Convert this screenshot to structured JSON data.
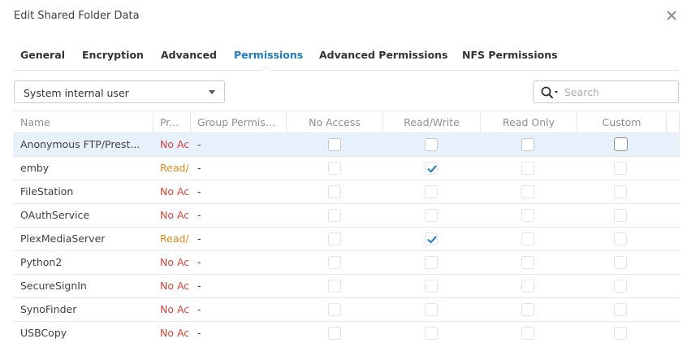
{
  "dialog": {
    "title": "Edit Shared Folder Data"
  },
  "tabs": [
    {
      "label": "General",
      "active": false
    },
    {
      "label": "Encryption",
      "active": false
    },
    {
      "label": "Advanced",
      "active": false
    },
    {
      "label": "Permissions",
      "active": true
    },
    {
      "label": "Advanced Permissions",
      "active": false
    },
    {
      "label": "NFS Permissions",
      "active": false
    }
  ],
  "filter": {
    "selected": "System internal user"
  },
  "search": {
    "placeholder": "Search"
  },
  "columns": {
    "name": "Name",
    "privilege": "Pr...",
    "group": "Group Permis...",
    "no_access": "No Access",
    "read_write": "Read/Write",
    "read_only": "Read Only",
    "custom": "Custom"
  },
  "rows": [
    {
      "name": "Anonymous FTP/Prest...",
      "privilege": "No Ac",
      "privilege_kind": "no",
      "group": "-",
      "no_access": false,
      "read_write": false,
      "read_only": false,
      "custom": false,
      "selected": true
    },
    {
      "name": "emby",
      "privilege": "Read/",
      "privilege_kind": "rw",
      "group": "-",
      "no_access": false,
      "read_write": true,
      "read_only": false,
      "custom": false,
      "selected": false
    },
    {
      "name": "FileStation",
      "privilege": "No Ac",
      "privilege_kind": "no",
      "group": "-",
      "no_access": false,
      "read_write": false,
      "read_only": false,
      "custom": false,
      "selected": false
    },
    {
      "name": "OAuthService",
      "privilege": "No Ac",
      "privilege_kind": "no",
      "group": "-",
      "no_access": false,
      "read_write": false,
      "read_only": false,
      "custom": false,
      "selected": false
    },
    {
      "name": "PlexMediaServer",
      "privilege": "Read/",
      "privilege_kind": "rw",
      "group": "-",
      "no_access": false,
      "read_write": true,
      "read_only": false,
      "custom": false,
      "selected": false
    },
    {
      "name": "Python2",
      "privilege": "No Ac",
      "privilege_kind": "no",
      "group": "-",
      "no_access": false,
      "read_write": false,
      "read_only": false,
      "custom": false,
      "selected": false
    },
    {
      "name": "SecureSignIn",
      "privilege": "No Ac",
      "privilege_kind": "no",
      "group": "-",
      "no_access": false,
      "read_write": false,
      "read_only": false,
      "custom": false,
      "selected": false
    },
    {
      "name": "SynoFinder",
      "privilege": "No Ac",
      "privilege_kind": "no",
      "group": "-",
      "no_access": false,
      "read_write": false,
      "read_only": false,
      "custom": false,
      "selected": false
    },
    {
      "name": "USBCopy",
      "privilege": "No Ac",
      "privilege_kind": "no",
      "group": "-",
      "no_access": false,
      "read_write": false,
      "read_only": false,
      "custom": false,
      "selected": false
    }
  ],
  "icons": {
    "close": "close-icon",
    "search": "search-icon",
    "check": "checkmark-icon"
  },
  "colors": {
    "accent": "#1f7bbf",
    "no_access": "#d9453a",
    "read_write": "#e08a1e",
    "selected_row": "#e7f1fb"
  }
}
